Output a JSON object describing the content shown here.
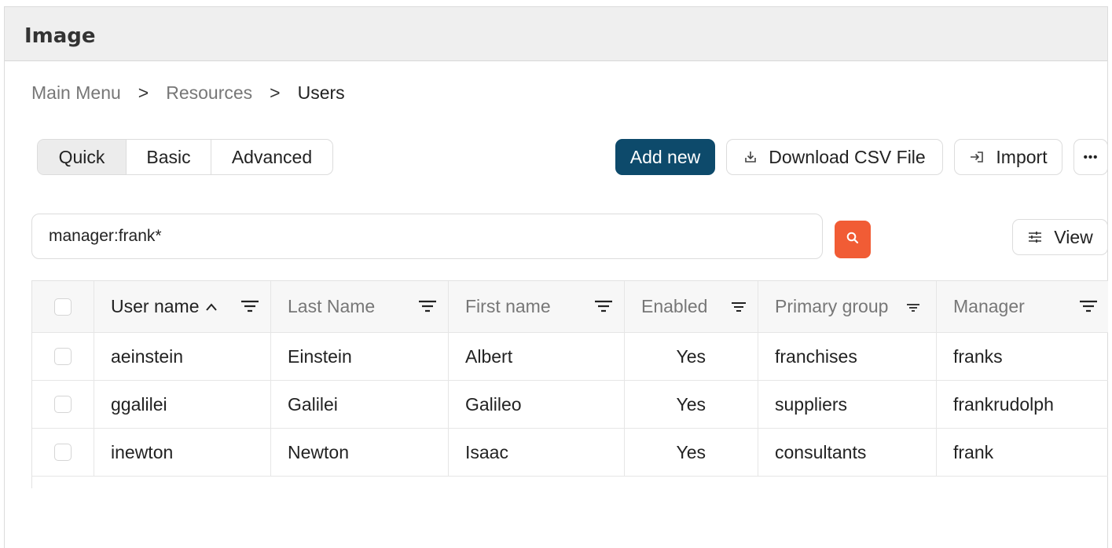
{
  "window": {
    "title": "Image"
  },
  "breadcrumb": {
    "items": [
      "Main Menu",
      "Resources",
      "Users"
    ],
    "separator": ">"
  },
  "search_modes": {
    "options": [
      "Quick",
      "Basic",
      "Advanced"
    ],
    "selected": "Quick"
  },
  "toolbar": {
    "add_new_label": "Add new",
    "download_label": "Download CSV File",
    "import_label": "Import",
    "more_label": "•••",
    "view_label": "View"
  },
  "search": {
    "value": "manager:frank*"
  },
  "table": {
    "columns": [
      "User name",
      "Last Name",
      "First name",
      "Enabled",
      "Primary group",
      "Manager"
    ],
    "sorted_column": "User name",
    "sort_direction": "ascending",
    "rows": [
      {
        "username": "aeinstein",
        "last_name": "Einstein",
        "first_name": "Albert",
        "enabled": "Yes",
        "primary_group": "franchises",
        "manager": "franks"
      },
      {
        "username": "ggalilei",
        "last_name": "Galilei",
        "first_name": "Galileo",
        "enabled": "Yes",
        "primary_group": "suppliers",
        "manager": "frankrudolph"
      },
      {
        "username": "inewton",
        "last_name": "Newton",
        "first_name": "Isaac",
        "enabled": "Yes",
        "primary_group": "consultants",
        "manager": "frank"
      }
    ]
  },
  "colors": {
    "primary": "#0d4a6b",
    "search_accent": "#f15c35"
  }
}
